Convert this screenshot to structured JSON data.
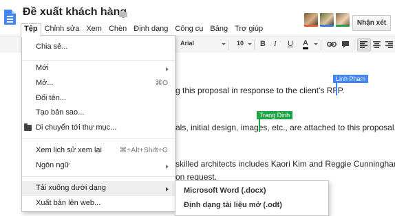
{
  "app": {
    "doc_title": "Đề xuất khách hàng",
    "icons": {
      "logo": "docs-logo-icon",
      "star": "star-icon",
      "folder": "folder-icon"
    }
  },
  "menubar": [
    "Tệp",
    "Chỉnh sửa",
    "Xem",
    "Chèn",
    "Định dạng",
    "Công cụ",
    "Bảng",
    "Trợ giúp"
  ],
  "collaborators": {
    "colors": [
      "#e05a2b",
      "#3c78d8",
      "#1ea446"
    ]
  },
  "header": {
    "comments_label": "Nhận xét"
  },
  "toolbar": {
    "font_name": "Arial",
    "font_size": "10",
    "text_color_label": "A",
    "icons": [
      "bold-icon",
      "italic-icon",
      "underline-icon",
      "text-color-icon",
      "link-icon",
      "comment-icon",
      "align-left-icon",
      "align-center-icon",
      "align-right-icon"
    ]
  },
  "document": {
    "lines": [
      "g this proposal in response to the client's RFP.",
      "als, initial design, images, etc., are attached to this proposal.",
      "skilled architects includes Kaori Kim and Reggie Cunningham.",
      "on request."
    ],
    "cursors": [
      {
        "name": "Linh Pham",
        "color": "#4285f4"
      },
      {
        "name": "Trang Dinh",
        "color": "#1ea446"
      }
    ]
  },
  "file_menu": {
    "items": [
      {
        "label": "Chia sẻ...",
        "shortcut": "",
        "submenu": false
      },
      {
        "label": "Mới",
        "shortcut": "",
        "submenu": true
      },
      {
        "label": "Mở...",
        "shortcut": "⌘O",
        "submenu": false
      },
      {
        "label": "Đổi tên...",
        "shortcut": "",
        "submenu": false
      },
      {
        "label": "Tạo bản sao...",
        "shortcut": "",
        "submenu": false
      },
      {
        "label": "Di chuyển tới thư mục...",
        "shortcut": "",
        "submenu": false
      },
      {
        "label": "Xem lịch sử xem lại",
        "shortcut": "⌘+Alt+Shift+G",
        "submenu": false
      },
      {
        "label": "Ngôn ngữ",
        "shortcut": "",
        "submenu": true
      },
      {
        "label": "Tải xuống dưới dạng",
        "shortcut": "",
        "submenu": true
      },
      {
        "label": "Xuất bản lên web...",
        "shortcut": "",
        "submenu": false
      }
    ]
  },
  "download_submenu": {
    "items": [
      "Microsoft Word (.docx)",
      "Định dạng tài liệu mở (.odt)"
    ]
  }
}
